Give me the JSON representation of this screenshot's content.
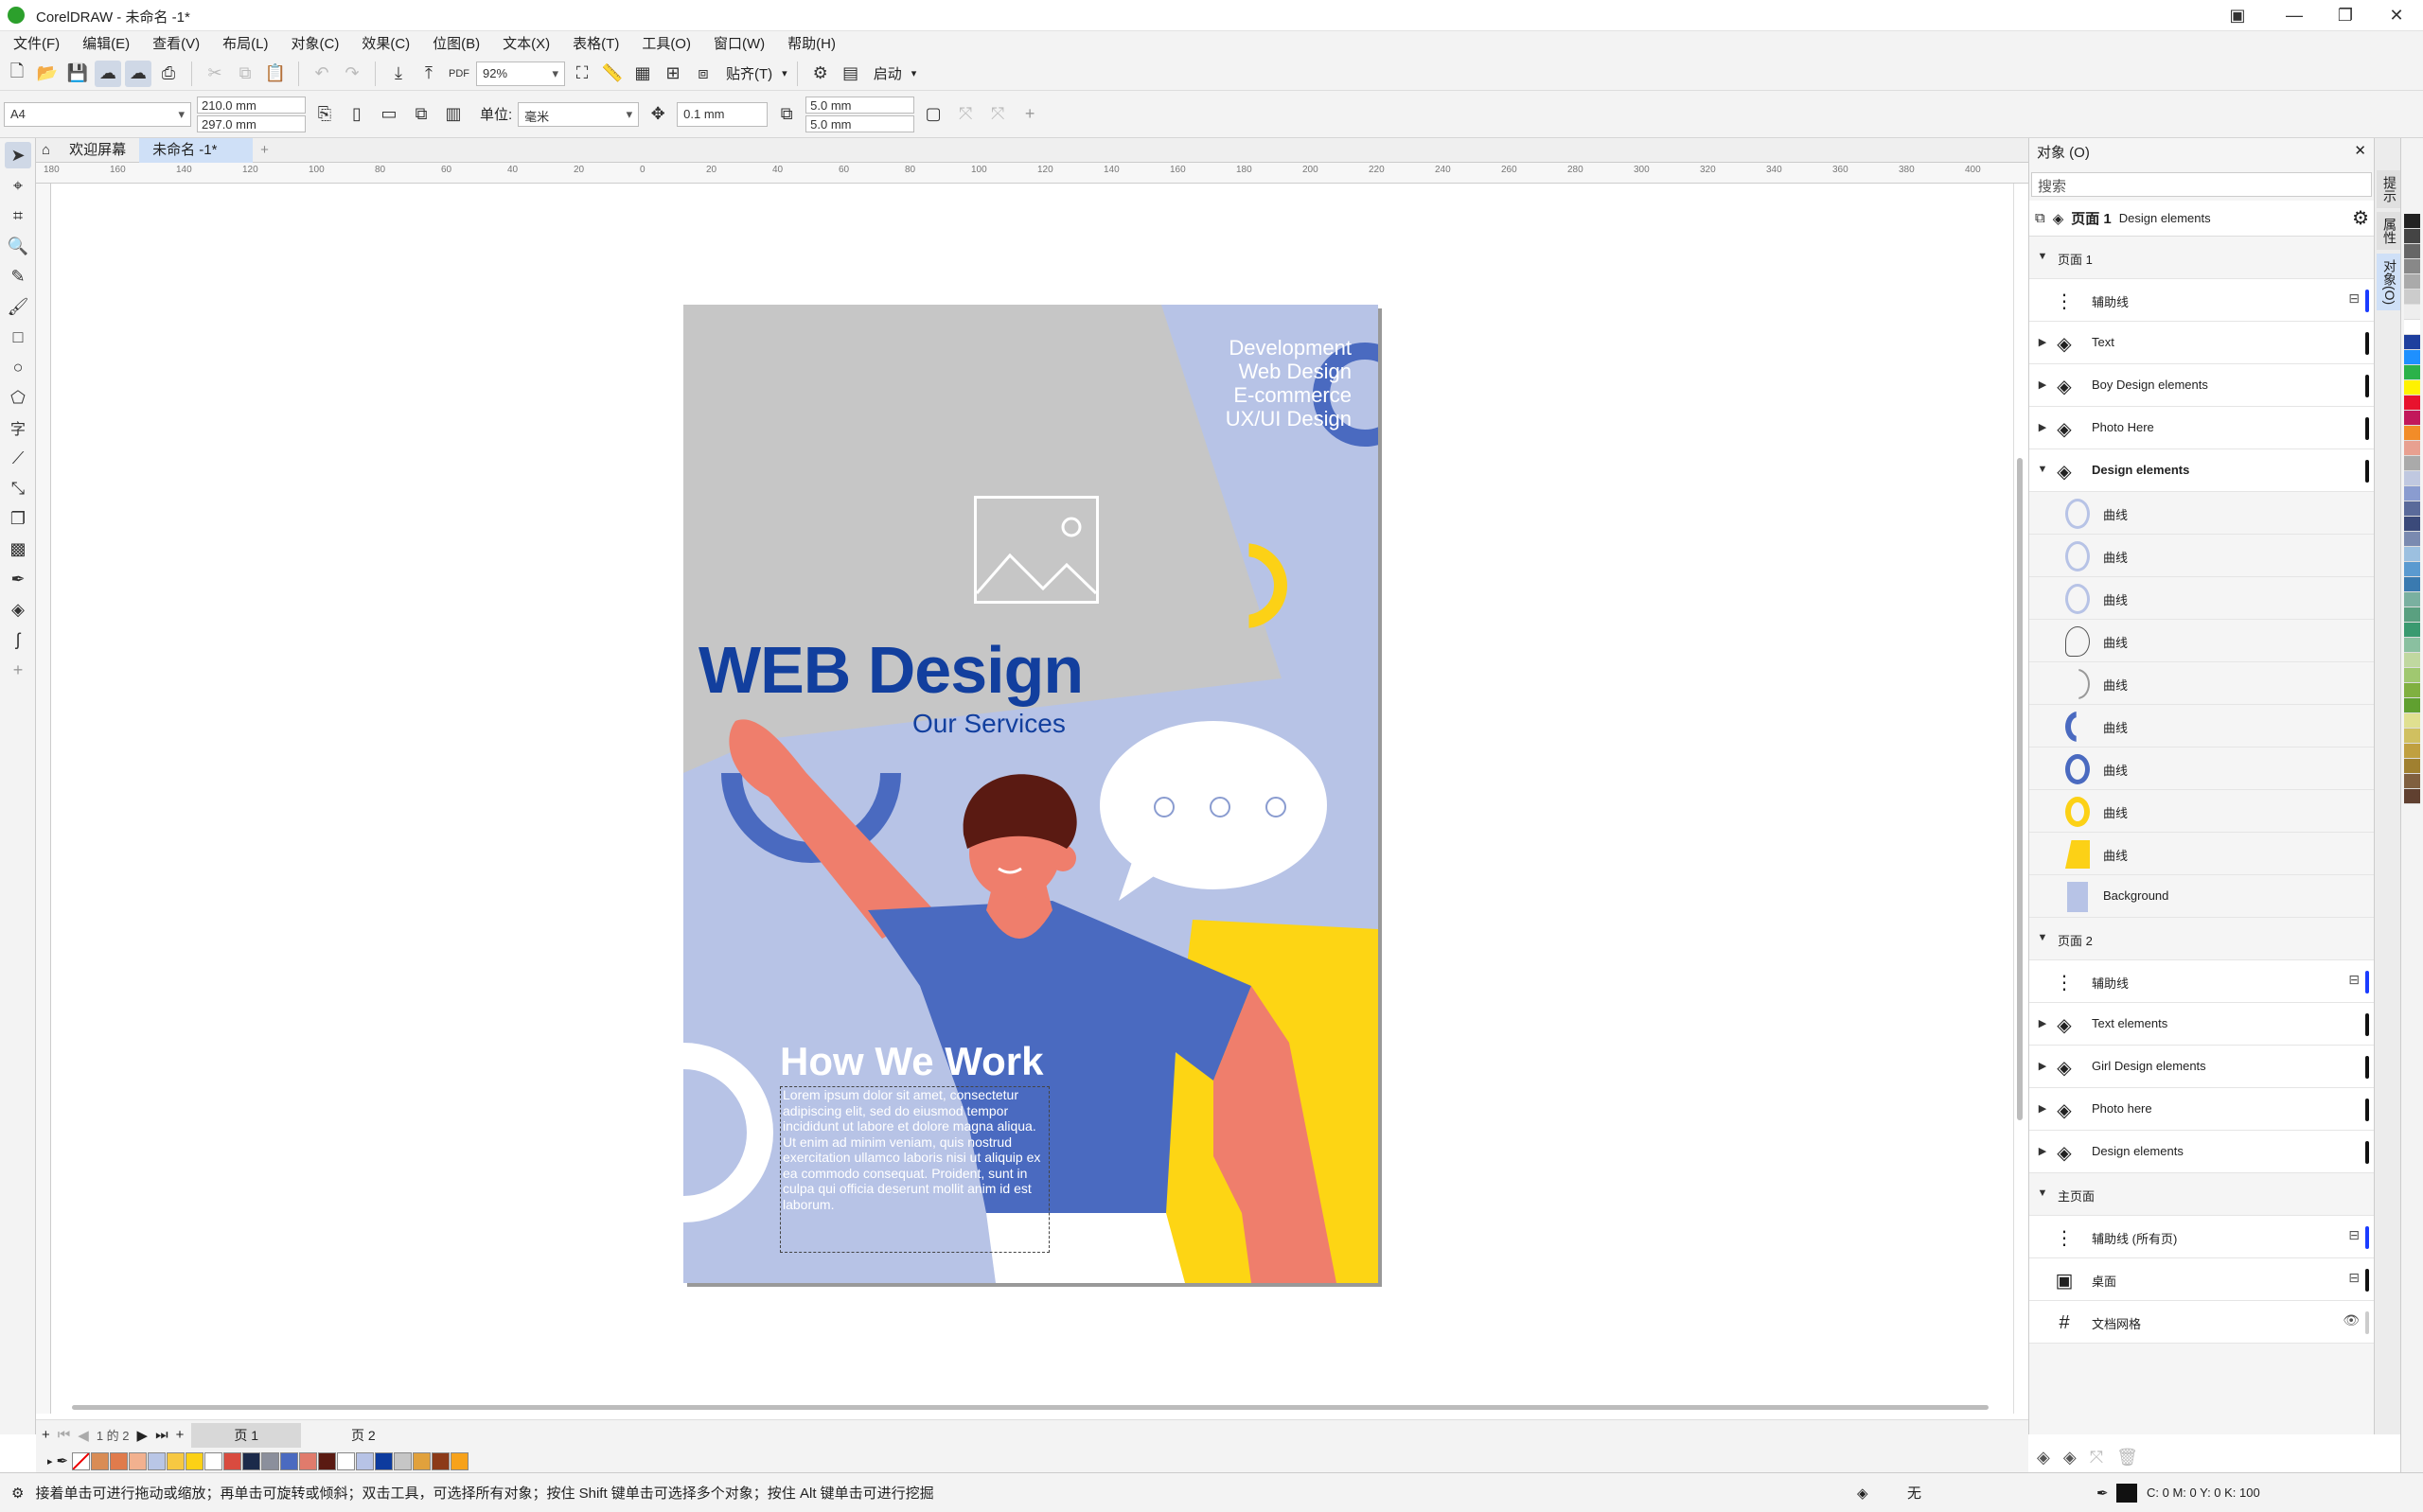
{
  "window": {
    "title": "CorelDRAW - 未命名 -1*"
  },
  "menu": [
    "文件(F)",
    "编辑(E)",
    "查看(V)",
    "布局(L)",
    "对象(C)",
    "效果(C)",
    "位图(B)",
    "文本(X)",
    "表格(T)",
    "工具(O)",
    "窗口(W)",
    "帮助(H)"
  ],
  "toolbar": {
    "zoom": "92%",
    "snap_label": "贴齐(T)",
    "launch_label": "启动"
  },
  "propbar": {
    "page_size": "A4",
    "width": "210.0 mm",
    "height": "297.0 mm",
    "units_label": "单位:",
    "units": "毫米",
    "nudge": "0.1 mm",
    "dup_x": "5.0 mm",
    "dup_y": "5.0 mm"
  },
  "doc_tabs": {
    "welcome": "欢迎屏幕",
    "doc": "未命名 -1*"
  },
  "ruler_ticks": [
    "180",
    "160",
    "140",
    "120",
    "100",
    "80",
    "60",
    "40",
    "20",
    "0",
    "20",
    "40",
    "60",
    "80",
    "100",
    "120",
    "140",
    "160",
    "180",
    "200",
    "220",
    "240",
    "260",
    "280",
    "300",
    "320",
    "340",
    "360",
    "380",
    "400"
  ],
  "design": {
    "services": [
      "Development",
      "Web Design",
      "E-commerce",
      "UX/UI Design"
    ],
    "headline": "WEB Design",
    "subheadline": "Our Services",
    "how_title": "How We Work",
    "body": "Lorem ipsum dolor sit amet, consectetur adipiscing elit, sed do eiusmod tempor incididunt ut labore et dolore magna aliqua. Ut enim ad minim veniam, quis nostrud exercitation ullamco laboris nisi ut aliquip ex ea commodo consequat. Proident, sunt in culpa qui officia deserunt mollit anim id est laborum."
  },
  "pages": {
    "counter": "1 的 2",
    "tabs": [
      "页 1",
      "页 2"
    ]
  },
  "objects": {
    "title": "对象 (O)",
    "search_placeholder": "搜索",
    "current_page": "页面 1",
    "current_layer": "Design elements",
    "page1": "页面 1",
    "guides": "辅助线",
    "p1_layers": [
      "Text",
      "Boy Design elements",
      "Photo Here",
      "Design elements"
    ],
    "curve": "曲线",
    "background": "Background",
    "page2": "页面 2",
    "p2_layers": [
      "Text elements",
      "Girl Design elements",
      "Photo here",
      "Design elements"
    ],
    "master": "主页面",
    "master_guides": "辅助线 (所有页)",
    "desktop": "桌面",
    "grid": "文档网格"
  },
  "side_tabs": [
    "提示",
    "属性",
    "对象(O)"
  ],
  "status": {
    "hint": "接着单击可进行拖动或缩放；再单击可旋转或倾斜；双击工具，可选择所有对象；按住 Shift 键单击可选择多个对象；按住 Alt 键单击可进行挖掘",
    "fill": "无",
    "cmyk": "C: 0 M: 0 Y: 0 K: 100"
  },
  "palette": [
    "#d98c55",
    "#e07b4c",
    "#f2b18f",
    "#b9c6e6",
    "#f7c842",
    "#fcd116",
    "#ffffff",
    "#d94b3f",
    "#1b2a4a",
    "#8b8f9c",
    "#4a6ac0",
    "#e07b6c",
    "#5a1a12",
    "#ffffff",
    "#b7c3e6",
    "#0d3b9e",
    "#c6c6c6",
    "#e1a13c",
    "#8c3a18",
    "#f7a21b"
  ],
  "right_palette": [
    "#222222",
    "#444444",
    "#666666",
    "#888888",
    "#aaaaaa",
    "#cccccc",
    "#eeeeee",
    "#ffffff",
    "#1e3f9e",
    "#1e90ff",
    "#2cb24a",
    "#fff200",
    "#e8122d",
    "#c2185b",
    "#f28c28",
    "#e8a090",
    "#aaaaaa",
    "#c0c8e0",
    "#8a9cd0",
    "#5a6a9a",
    "#3b4a7a",
    "#7a8ab0",
    "#9cc0e0",
    "#5a9ad0",
    "#3a7ab0",
    "#7ab0a0",
    "#5aa080",
    "#3a9a70",
    "#8ac0a0",
    "#c0d8a0",
    "#a0c870",
    "#80b040",
    "#60a030",
    "#e0e090",
    "#d0c060",
    "#c0a040",
    "#a08030",
    "#806040",
    "#604030"
  ]
}
